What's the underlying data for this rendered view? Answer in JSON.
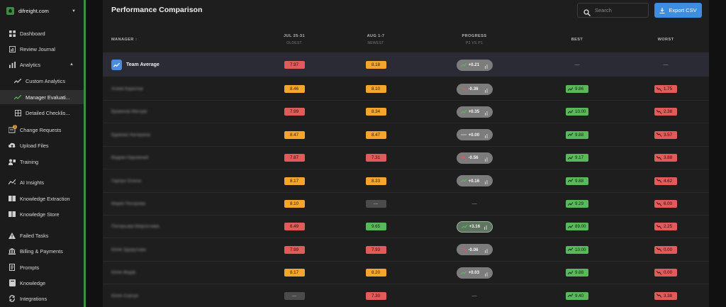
{
  "workspace": {
    "name": "difreight.com"
  },
  "sidebar": {
    "items": [
      {
        "label": "Dashboard",
        "icon": "dashboard-icon"
      },
      {
        "label": "Review Journal",
        "icon": "journal-icon"
      },
      {
        "label": "Analytics",
        "icon": "analytics-icon"
      },
      {
        "label": "Custom Analytics",
        "icon": "trend-icon"
      },
      {
        "label": "Manager Evaluati...",
        "icon": "trend-icon"
      },
      {
        "label": "Detailed Checklis...",
        "icon": "grid-icon"
      },
      {
        "label": "Change Requests",
        "icon": "change-requests-icon",
        "badge": "1"
      },
      {
        "label": "Upload Files",
        "icon": "upload-icon"
      },
      {
        "label": "Training",
        "icon": "training-icon"
      },
      {
        "label": "AI Insights",
        "icon": "ai-insights-icon"
      },
      {
        "label": "Knowledge Extraction",
        "icon": "knowledge-extraction-icon"
      },
      {
        "label": "Knowledge Store",
        "icon": "knowledge-store-icon"
      },
      {
        "label": "Failed Tasks",
        "icon": "warning-icon"
      },
      {
        "label": "Billing & Payments",
        "icon": "billing-icon"
      },
      {
        "label": "Prompts",
        "icon": "prompts-icon"
      },
      {
        "label": "Knowledge",
        "icon": "knowledge-icon"
      },
      {
        "label": "Integrations",
        "icon": "integrations-icon"
      }
    ]
  },
  "panel": {
    "title": "Performance Comparison",
    "search_placeholder": "Search",
    "export_label": "Export CSV"
  },
  "table": {
    "headers": {
      "manager": "MANAGER ↑",
      "jul": "JUL 25-31",
      "jul_sub": "OLDEST",
      "aug": "AUG 1-7",
      "aug_sub": "NEWEST",
      "progress": "PROGRESS",
      "progress_sub": "P2 VS P1",
      "best": "BEST",
      "worst": "WORST"
    },
    "average": {
      "name": "Team Average",
      "jul": "7.97",
      "aug": "8.18",
      "progress": "+0.21",
      "best": "—",
      "worst": "—"
    },
    "rows": [
      {
        "name": "Агеев Кирилов",
        "jul": "8.46",
        "aug": "8.10",
        "progress": "-0.36",
        "best": "9.86",
        "worst": "1.75"
      },
      {
        "name": "Бражнов Мегорв",
        "jul": "7.99",
        "aug": "8.34",
        "progress": "+0.35",
        "best": "10.00",
        "worst": "2.38"
      },
      {
        "name": "Буренко Катерина",
        "jul": "8.47",
        "aug": "8.47",
        "progress": "+0.00",
        "best": "9.88",
        "worst": "3.57"
      },
      {
        "name": "Вадим Нарожний",
        "jul": "7.87",
        "aug": "7.31",
        "progress": "-0.56",
        "best": "9.17",
        "worst": "3.88"
      },
      {
        "name": "Гарпун Олена",
        "jul": "8.17",
        "aug": "8.33",
        "progress": "+0.16",
        "best": "9.88",
        "worst": "4.62"
      },
      {
        "name": "Марія Погорова",
        "jul": "8.10",
        "aug": "—",
        "progress": "—",
        "best": "9.29",
        "worst": "6.00"
      },
      {
        "name": "Погорьова Мирослава",
        "jul": "6.49",
        "aug": "9.65",
        "progress": "+3.16",
        "best": "89.00",
        "worst": "2.25"
      },
      {
        "name": "Юлія Здорутова",
        "jul": "7.99",
        "aug": "7.93",
        "progress": "-0.06",
        "best": "10.00",
        "worst": "0.00"
      },
      {
        "name": "Юлія Фадів",
        "jul": "8.17",
        "aug": "8.20",
        "progress": "+0.03",
        "best": "9.88",
        "worst": "0.00"
      },
      {
        "name": "Юлія Сорчук",
        "jul": "—",
        "aug": "7.30",
        "progress": "—",
        "best": "9.40",
        "worst": "3.38"
      }
    ]
  },
  "colors": {
    "accent": "#3e8e41",
    "primary_button": "#3d8de0",
    "good": "#5ab85c",
    "mid": "#f4a52b",
    "bad": "#e25b5b"
  }
}
